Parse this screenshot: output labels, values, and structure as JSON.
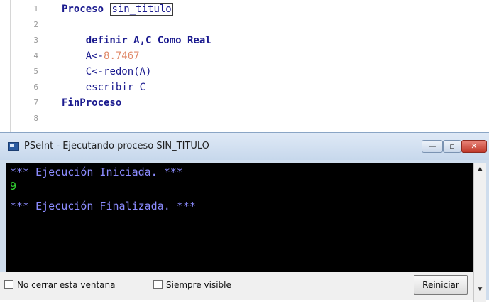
{
  "editor": {
    "lines": [
      {
        "num": "1",
        "parts": [
          {
            "t": "Proceso ",
            "c": "kw"
          },
          {
            "t": "sin_titulo",
            "c": "cursor"
          }
        ]
      },
      {
        "num": "2",
        "parts": []
      },
      {
        "num": "3",
        "parts": [
          {
            "t": "    definir A,C Como Real",
            "c": "kw"
          }
        ]
      },
      {
        "num": "4",
        "parts": [
          {
            "t": "    A<-",
            "c": "id"
          },
          {
            "t": "8.7467",
            "c": "num"
          }
        ]
      },
      {
        "num": "5",
        "parts": [
          {
            "t": "    C<-",
            "c": "id"
          },
          {
            "t": "redon",
            "c": "fn"
          },
          {
            "t": "(A)",
            "c": "id"
          }
        ]
      },
      {
        "num": "6",
        "parts": [
          {
            "t": "    escribir C",
            "c": "id"
          }
        ]
      },
      {
        "num": "7",
        "parts": [
          {
            "t": "FinProceso",
            "c": "kw"
          }
        ]
      },
      {
        "num": "8",
        "parts": []
      }
    ]
  },
  "window": {
    "title": "PSeInt - Ejecutando proceso SIN_TITULO",
    "icon": "app-window-icon",
    "buttons": {
      "minimize": "—",
      "maximize": "▫",
      "close": "✕"
    }
  },
  "console": {
    "lines": [
      {
        "text": "*** Ejecución Iniciada. ***",
        "color": "blue"
      },
      {
        "text": "9",
        "color": "green"
      },
      {
        "text": "*** Ejecución Finalizada. ***",
        "color": "blue"
      }
    ]
  },
  "footer": {
    "checkbox_close": "No cerrar esta ventana",
    "checkbox_visible": "Siempre visible",
    "restart": "Reiniciar"
  },
  "scrollbar": {
    "up": "▲",
    "down": "▼"
  },
  "colors": {
    "console_bg": "#000000",
    "console_blue": "#8c8cff",
    "console_green": "#33d633",
    "keyword": "#1b1b8f",
    "number": "#e08a6a"
  }
}
